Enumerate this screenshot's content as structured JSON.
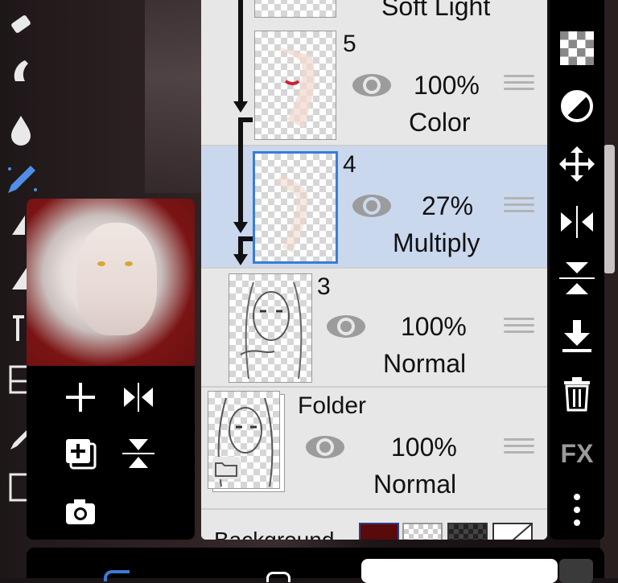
{
  "layers": [
    {
      "num": "",
      "opacity": "",
      "blend": "Soft Light",
      "selected": false,
      "clipped": true
    },
    {
      "num": "5",
      "opacity": "100%",
      "blend": "Color",
      "selected": false,
      "clipped": true
    },
    {
      "num": "4",
      "opacity": "27%",
      "blend": "Multiply",
      "selected": true,
      "clipped": true
    },
    {
      "num": "3",
      "opacity": "100%",
      "blend": "Normal",
      "selected": false,
      "clipped": false
    },
    {
      "num": "Folder",
      "opacity": "100%",
      "blend": "Normal",
      "selected": false,
      "clipped": false
    }
  ],
  "background_label": "Background",
  "right_bar": {
    "fx_label": "FX"
  },
  "icons": {
    "left_tools": [
      "eraser-icon",
      "smudge-icon",
      "blur-drop-icon",
      "brush-icon",
      "fill-icon",
      "text-icon",
      "frame-icon",
      "pen-icon",
      "select-icon"
    ],
    "preview_actions": [
      "add-layer-icon",
      "flip-horizontal-icon",
      "duplicate-layer-icon",
      "flip-vertical-icon",
      "camera-icon"
    ],
    "right_actions": [
      "transparency-icon",
      "contrast-icon",
      "move-icon",
      "flip-horizontal-icon",
      "flip-vertical-icon",
      "merge-down-icon",
      "trash-icon",
      "fx-icon",
      "more-icon"
    ]
  },
  "colors": {
    "accent": "#3a7cd6",
    "selected_row": "#cad8ee",
    "bg_swatch": "#5a0a0a"
  }
}
